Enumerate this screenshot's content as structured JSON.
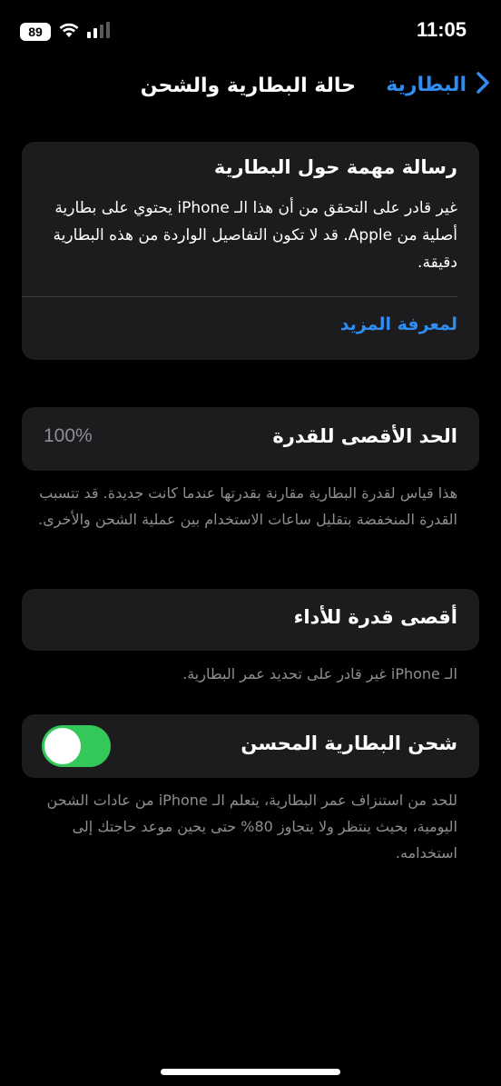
{
  "status_bar": {
    "time": "11:05",
    "battery_level": "89",
    "wifi_icon": "wifi-icon",
    "signal_icon": "cellular-signal-icon"
  },
  "nav": {
    "back_label": "البطارية",
    "back_icon": "chevron-right-icon",
    "title": "حالة البطارية والشحن"
  },
  "important_message": {
    "title": "رسالة مهمة حول البطارية",
    "body": "غير قادر على التحقق من أن هذا الـ iPhone يحتوي على بطارية أصلية من Apple. قد لا تكون التفاصيل الواردة من هذه البطارية دقيقة.",
    "link_label": "لمعرفة المزيد"
  },
  "maximum_capacity": {
    "label": "الحد الأقصى للقدرة",
    "value": "100%",
    "footnote": "هذا قياس لقدرة البطارية مقارنة بقدرتها عندما كانت جديدة. قد تتسبب القدرة المنخفضة بتقليل ساعات الاستخدام بين عملية الشحن والأخرى."
  },
  "peak_performance": {
    "label": "أقصى قدرة للأداء",
    "footnote": "الـ iPhone غير قادر على تحديد عمر البطارية."
  },
  "optimized_charging": {
    "label": "شحن البطارية المحسن",
    "enabled": true,
    "footnote": "للحد من استنزاف عمر البطارية، يتعلم الـ iPhone من عادات الشحن اليومية، بحيث ينتظر ولا يتجاوز 80% حتى يحين موعد حاجتك إلى استخدامه."
  },
  "colors": {
    "accent_blue": "#2f8cf0",
    "toggle_green": "#34c759",
    "card_bg": "#1c1c1e",
    "secondary_text": "#8e8e93"
  }
}
